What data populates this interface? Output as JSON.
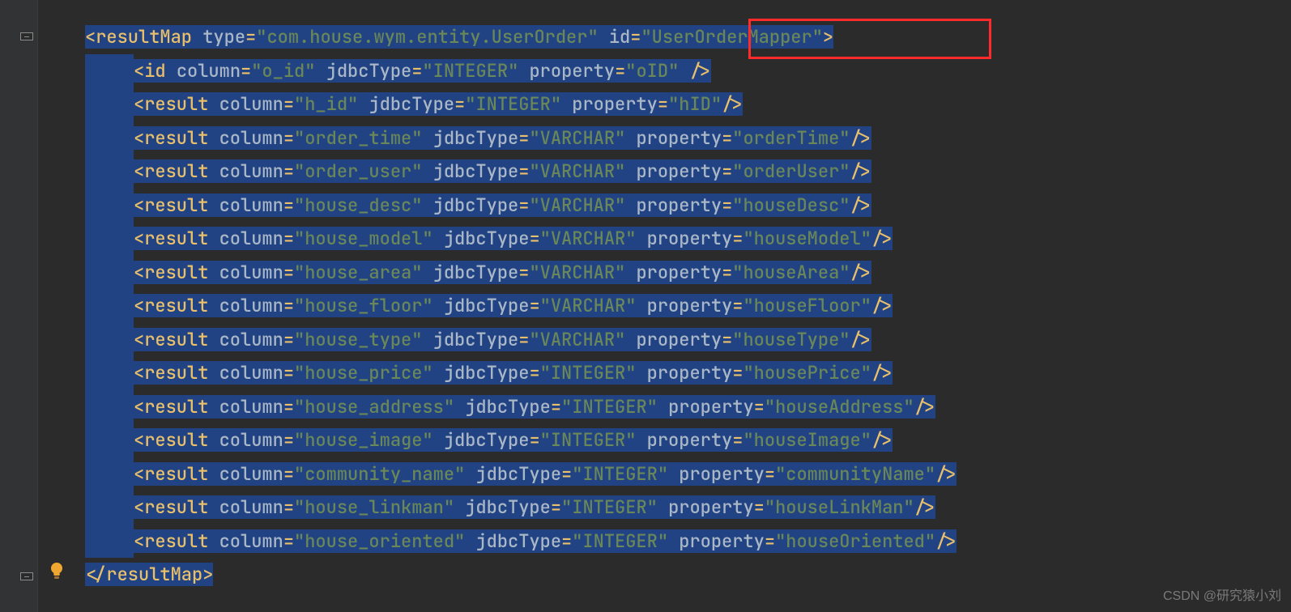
{
  "code": {
    "resultMapOpen": {
      "tag": "resultMap",
      "typeAttr": "type",
      "typeVal": "com.house.wym.entity.UserOrder",
      "idAttr": "id",
      "idVal": "UserOrderMapper"
    },
    "idElem": {
      "tag": "id",
      "columnAttr": "column",
      "columnVal": "o_id",
      "jdbcAttr": "jdbcType",
      "jdbcVal": "INTEGER",
      "propAttr": "property",
      "propVal": "oID"
    },
    "results": [
      {
        "tag": "result",
        "columnAttr": "column",
        "columnVal": "h_id",
        "jdbcAttr": "jdbcType",
        "jdbcVal": "INTEGER",
        "propAttr": "property",
        "propVal": "hID"
      },
      {
        "tag": "result",
        "columnAttr": "column",
        "columnVal": "order_time",
        "jdbcAttr": "jdbcType",
        "jdbcVal": "VARCHAR",
        "propAttr": "property",
        "propVal": "orderTime"
      },
      {
        "tag": "result",
        "columnAttr": "column",
        "columnVal": "order_user",
        "jdbcAttr": "jdbcType",
        "jdbcVal": "VARCHAR",
        "propAttr": "property",
        "propVal": "orderUser"
      },
      {
        "tag": "result",
        "columnAttr": "column",
        "columnVal": "house_desc",
        "jdbcAttr": "jdbcType",
        "jdbcVal": "VARCHAR",
        "propAttr": "property",
        "propVal": "houseDesc"
      },
      {
        "tag": "result",
        "columnAttr": "column",
        "columnVal": "house_model",
        "jdbcAttr": "jdbcType",
        "jdbcVal": "VARCHAR",
        "propAttr": "property",
        "propVal": "houseModel"
      },
      {
        "tag": "result",
        "columnAttr": "column",
        "columnVal": "house_area",
        "jdbcAttr": "jdbcType",
        "jdbcVal": "VARCHAR",
        "propAttr": "property",
        "propVal": "houseArea"
      },
      {
        "tag": "result",
        "columnAttr": "column",
        "columnVal": "house_floor",
        "jdbcAttr": "jdbcType",
        "jdbcVal": "VARCHAR",
        "propAttr": "property",
        "propVal": "houseFloor"
      },
      {
        "tag": "result",
        "columnAttr": "column",
        "columnVal": "house_type",
        "jdbcAttr": "jdbcType",
        "jdbcVal": "VARCHAR",
        "propAttr": "property",
        "propVal": "houseType"
      },
      {
        "tag": "result",
        "columnAttr": "column",
        "columnVal": "house_price",
        "jdbcAttr": "jdbcType",
        "jdbcVal": "INTEGER",
        "propAttr": "property",
        "propVal": "housePrice"
      },
      {
        "tag": "result",
        "columnAttr": "column",
        "columnVal": "house_address",
        "jdbcAttr": "jdbcType",
        "jdbcVal": "INTEGER",
        "propAttr": "property",
        "propVal": "houseAddress"
      },
      {
        "tag": "result",
        "columnAttr": "column",
        "columnVal": "house_image",
        "jdbcAttr": "jdbcType",
        "jdbcVal": "INTEGER",
        "propAttr": "property",
        "propVal": "houseImage"
      },
      {
        "tag": "result",
        "columnAttr": "column",
        "columnVal": "community_name",
        "jdbcAttr": "jdbcType",
        "jdbcVal": "INTEGER",
        "propAttr": "property",
        "propVal": "communityName"
      },
      {
        "tag": "result",
        "columnAttr": "column",
        "columnVal": "house_linkman",
        "jdbcAttr": "jdbcType",
        "jdbcVal": "INTEGER",
        "propAttr": "property",
        "propVal": "houseLinkMan"
      },
      {
        "tag": "result",
        "columnAttr": "column",
        "columnVal": "house_oriented",
        "jdbcAttr": "jdbcType",
        "jdbcVal": "INTEGER",
        "propAttr": "property",
        "propVal": "houseOriented"
      }
    ],
    "resultMapClose": "resultMap"
  },
  "watermark": "CSDN @研究猿小刘"
}
